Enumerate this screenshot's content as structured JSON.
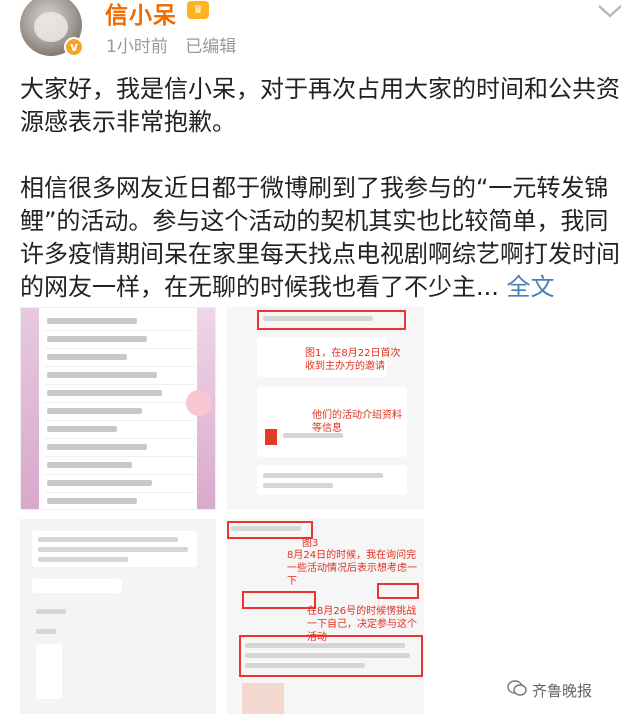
{
  "header": {
    "username": "信小呆",
    "time": "1小时前",
    "edited": "已编辑"
  },
  "post": {
    "paragraph1": "大家好，我是信小呆，对于再次占用大家的时间和公共资源感表示非常抱歉。",
    "paragraph2": "相信很多网友近日都于微博刷到了我参与的“一元转发锦鲤”的活动。参与这个活动的契机其实也比较简单，我同许多疫情期间呆在家里每天找点电视剧啊综艺啊打发时间的网友一样，在无聊的时候我也看了不少主... ",
    "full_text_link": "全文"
  },
  "images": {
    "img2": {
      "label1": "图1，在8月22日首次收到主办方的邀请",
      "label2": "他们的活动介绍资料等信息"
    },
    "img4": {
      "label1": "图3",
      "label2": "8月24日的时候，我在询问完一些活动情况后表示想考虑一下",
      "label3": "在8月26号的时候愣挑战一下自己，决定参与这个活动"
    }
  },
  "watermark": "齐鲁晚报",
  "colors": {
    "username": "#f06a00",
    "link": "#4a7fb8",
    "annotation": "#e0301e"
  }
}
